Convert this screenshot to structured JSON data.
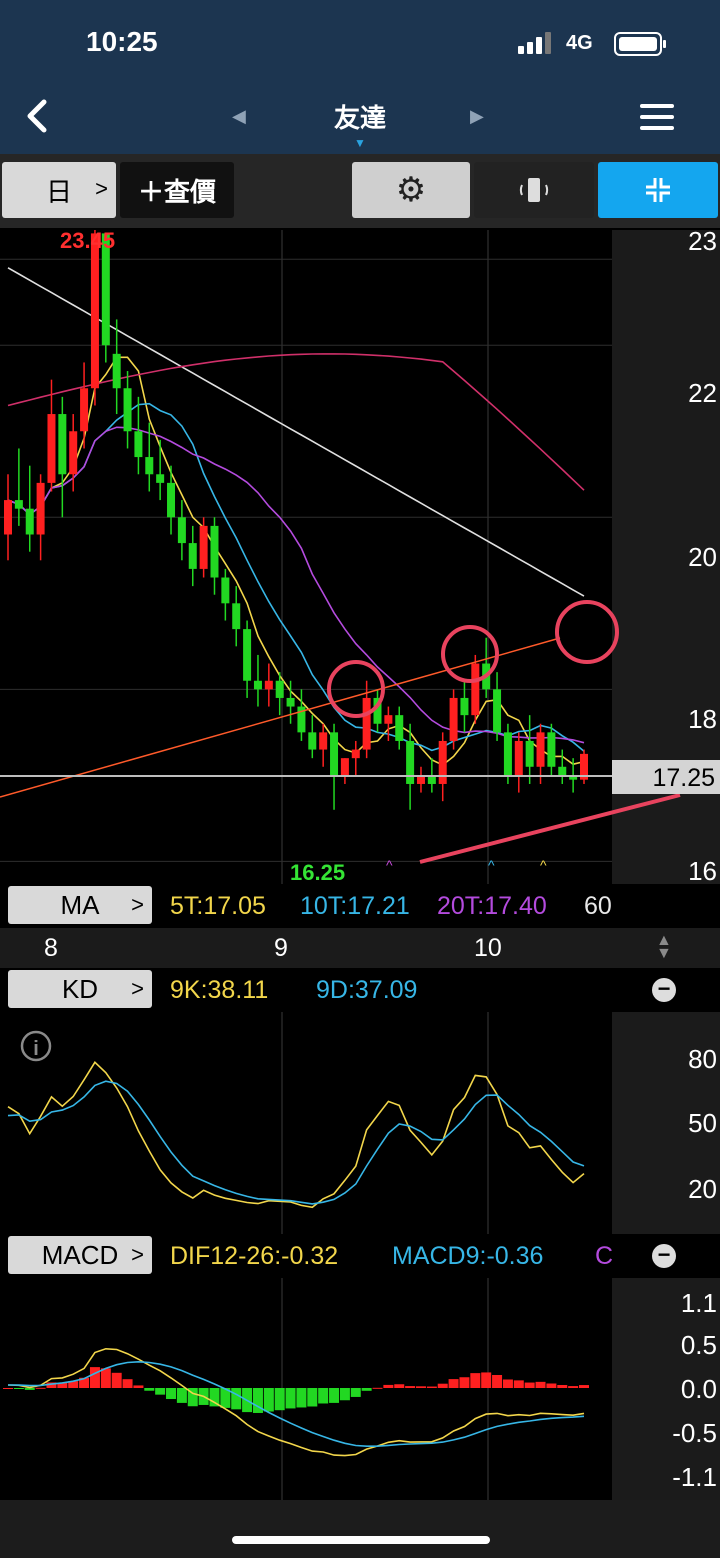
{
  "status_bar": {
    "time": "10:25",
    "network": "4G"
  },
  "nav": {
    "title": "友達",
    "back_icon": "chevron-left-icon",
    "menu_icon": "hamburger-menu-icon"
  },
  "toolbar": {
    "period_label": "日",
    "period_chevron": ">",
    "quote_label": "＋查價"
  },
  "main_chart": {
    "high_label": "23.45",
    "low_label": "16.25",
    "current_price": "17.25",
    "y_ticks": [
      "23",
      "22",
      "20",
      "18",
      "16"
    ]
  },
  "ma": {
    "label": "MA",
    "chevron": ">",
    "values": [
      {
        "text": "5T:17.05",
        "color": "#f2d64b"
      },
      {
        "text": "10T:17.21",
        "color": "#37b6e6"
      },
      {
        "text": "20T:17.40",
        "color": "#b44bde"
      },
      {
        "text": "60",
        "color": "#e8e8e8"
      }
    ]
  },
  "dates": [
    "8",
    "9",
    "10"
  ],
  "kd": {
    "label": "KD",
    "chevron": ">",
    "k": "9K:38.11",
    "d": "9D:37.09",
    "y_ticks": [
      "80",
      "50",
      "20"
    ]
  },
  "macd": {
    "label": "MACD",
    "chevron": ">",
    "dif": "DIF12-26:-0.32",
    "macd9": "MACD9:-0.36",
    "osc": "C",
    "y_ticks": [
      "1.1",
      "0.5",
      "0.0",
      "-0.5",
      "-1.1"
    ]
  },
  "chart_data": [
    {
      "type": "candlestick",
      "title": "",
      "ylim": [
        15.9,
        23.2
      ],
      "y_ticks": [
        23,
        22,
        20,
        18,
        16
      ],
      "x_labels": [
        "8",
        "9",
        "10"
      ],
      "candles": [
        [
          19.8,
          20.5,
          19.5,
          20.2
        ],
        [
          20.2,
          20.8,
          19.9,
          20.1
        ],
        [
          20.1,
          20.6,
          19.6,
          19.8
        ],
        [
          19.8,
          20.5,
          19.5,
          20.4
        ],
        [
          20.4,
          21.6,
          20.3,
          21.2
        ],
        [
          21.2,
          21.4,
          20.0,
          20.5
        ],
        [
          20.5,
          21.2,
          20.3,
          21.0
        ],
        [
          21.0,
          21.8,
          20.8,
          21.5
        ],
        [
          21.5,
          23.45,
          21.3,
          23.3
        ],
        [
          23.3,
          23.3,
          21.8,
          22.0
        ],
        [
          21.9,
          22.3,
          21.2,
          21.5
        ],
        [
          21.5,
          21.7,
          20.8,
          21.0
        ],
        [
          21.0,
          21.4,
          20.5,
          20.7
        ],
        [
          20.7,
          21.1,
          20.3,
          20.5
        ],
        [
          20.5,
          20.9,
          20.2,
          20.4
        ],
        [
          20.4,
          20.6,
          19.8,
          20.0
        ],
        [
          20.0,
          20.2,
          19.5,
          19.7
        ],
        [
          19.7,
          19.9,
          19.2,
          19.4
        ],
        [
          19.4,
          20.0,
          19.3,
          19.9
        ],
        [
          19.9,
          20.0,
          19.1,
          19.3
        ],
        [
          19.3,
          19.4,
          18.8,
          19.0
        ],
        [
          19.0,
          19.2,
          18.5,
          18.7
        ],
        [
          18.7,
          18.8,
          17.9,
          18.1
        ],
        [
          18.1,
          18.4,
          17.8,
          18.0
        ],
        [
          18.0,
          18.3,
          17.8,
          18.1
        ],
        [
          18.1,
          18.2,
          17.7,
          17.9
        ],
        [
          17.9,
          18.1,
          17.6,
          17.8
        ],
        [
          17.8,
          18.0,
          17.4,
          17.5
        ],
        [
          17.5,
          17.7,
          17.2,
          17.3
        ],
        [
          17.3,
          17.6,
          17.1,
          17.5
        ],
        [
          17.5,
          17.6,
          16.6,
          17.0
        ],
        [
          17.0,
          17.2,
          16.9,
          17.2
        ],
        [
          17.2,
          17.4,
          17.0,
          17.3
        ],
        [
          17.3,
          18.1,
          17.2,
          17.9
        ],
        [
          17.9,
          18.0,
          17.5,
          17.6
        ],
        [
          17.6,
          17.8,
          17.4,
          17.7
        ],
        [
          17.7,
          17.8,
          17.3,
          17.4
        ],
        [
          17.4,
          17.6,
          16.6,
          16.9
        ],
        [
          16.9,
          17.1,
          16.8,
          17.0
        ],
        [
          17.0,
          17.2,
          16.8,
          16.9
        ],
        [
          16.9,
          17.5,
          16.7,
          17.4
        ],
        [
          17.4,
          18.0,
          17.3,
          17.9
        ],
        [
          17.9,
          18.1,
          17.5,
          17.7
        ],
        [
          17.7,
          18.4,
          17.6,
          18.3
        ],
        [
          18.3,
          18.6,
          17.9,
          18.0
        ],
        [
          18.0,
          18.2,
          17.4,
          17.5
        ],
        [
          17.5,
          17.6,
          16.9,
          17.0
        ],
        [
          17.0,
          17.5,
          16.8,
          17.4
        ],
        [
          17.4,
          17.7,
          16.9,
          17.1
        ],
        [
          17.1,
          17.6,
          16.9,
          17.5
        ],
        [
          17.5,
          17.6,
          17.0,
          17.1
        ],
        [
          17.1,
          17.3,
          16.9,
          17.0
        ],
        [
          17.0,
          17.2,
          16.8,
          16.95
        ],
        [
          16.95,
          17.3,
          16.9,
          17.25
        ]
      ]
    },
    {
      "type": "line",
      "title": "",
      "ylim": [
        0,
        100
      ],
      "y_ticks": [
        80,
        50,
        20
      ],
      "series_count": 2
    },
    {
      "type": "bar",
      "title": "",
      "ylim": [
        -1.1,
        1.1
      ],
      "y_ticks": [
        1.1,
        0.5,
        0.0,
        -0.5,
        -1.1
      ]
    }
  ],
  "colors": {
    "up": "#ff2020",
    "down": "#22d822",
    "accent": "#14a6ef",
    "annotation": "#e8435e"
  }
}
